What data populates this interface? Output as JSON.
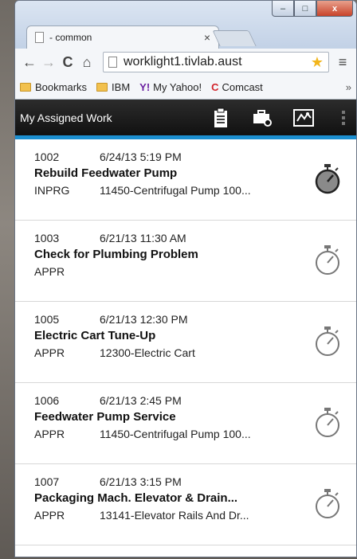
{
  "browser": {
    "tab_title": "- common",
    "tab_close": "×",
    "url": "worklight1.tivlab.aust",
    "bookmarks": [
      {
        "label": "Bookmarks",
        "icon": "folder-icon"
      },
      {
        "label": "IBM",
        "icon": "folder-icon"
      },
      {
        "label": "My Yahoo!",
        "icon": "yahoo-icon",
        "glyph": "Y!"
      },
      {
        "label": "Comcast",
        "icon": "comcast-icon",
        "glyph": "C"
      }
    ],
    "bookmarks_more": "»",
    "window_controls": {
      "minimize": "–",
      "maximize": "□",
      "close": "x"
    },
    "nav": {
      "back": "←",
      "forward": "→",
      "reload": "C",
      "home": "⌂",
      "menu": "≡",
      "star": "★"
    }
  },
  "app": {
    "title": "My Assigned Work",
    "accent_color": "#1c8fd0",
    "header_icons": [
      "clipboard-icon",
      "toolbox-icon",
      "map-icon",
      "more-icon"
    ]
  },
  "work_orders": [
    {
      "id": "1002",
      "date": "6/24/13 5:19 PM",
      "title": "Rebuild Feedwater Pump",
      "status": "INPRG",
      "asset": "11450-Centrifugal Pump 100...",
      "timer_active": true
    },
    {
      "id": "1003",
      "date": "6/21/13 11:30 AM",
      "title": "Check for Plumbing Problem",
      "status": "APPR",
      "asset": "",
      "timer_active": false
    },
    {
      "id": "1005",
      "date": "6/21/13 12:30 PM",
      "title": "Electric Cart Tune-Up",
      "status": "APPR",
      "asset": "12300-Electric Cart",
      "timer_active": false
    },
    {
      "id": "1006",
      "date": "6/21/13 2:45 PM",
      "title": "Feedwater Pump Service",
      "status": "APPR",
      "asset": "11450-Centrifugal Pump 100...",
      "timer_active": false
    },
    {
      "id": "1007",
      "date": "6/21/13 3:15 PM",
      "title": "Packaging Mach. Elevator & Drain...",
      "status": "APPR",
      "asset": "13141-Elevator Rails And Dr...",
      "timer_active": false
    }
  ]
}
